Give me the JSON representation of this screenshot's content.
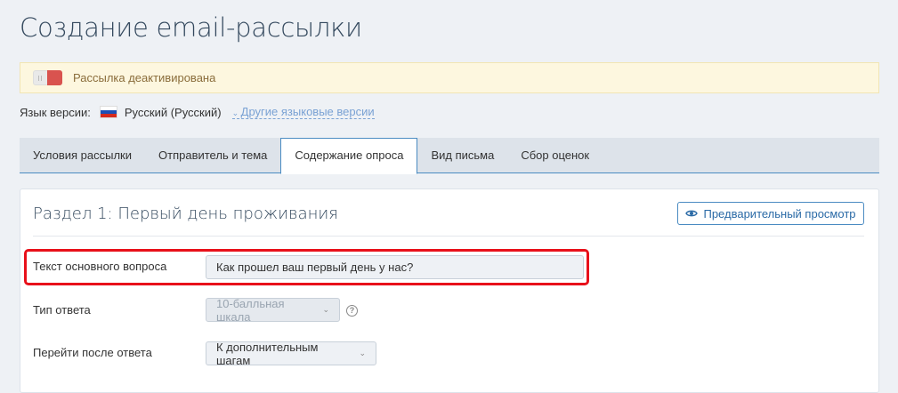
{
  "page_title": "Создание email-рассылки",
  "status_banner": {
    "text": "Рассылка деактивирована",
    "active": false
  },
  "language": {
    "label": "Язык версии:",
    "current": "Русский (Русский)",
    "other_link": "Другие языковые версии"
  },
  "tabs": [
    {
      "label": "Условия рассылки"
    },
    {
      "label": "Отправитель и тема"
    },
    {
      "label": "Содержание опроса",
      "active": true
    },
    {
      "label": "Вид письма"
    },
    {
      "label": "Сбор оценок"
    }
  ],
  "section": {
    "title": "Раздел 1: Первый день проживания",
    "preview_button": "Предварительный просмотр"
  },
  "fields": {
    "question_label": "Текст основного вопроса",
    "question_value": "Как прошел ваш первый день у нас?",
    "answer_type_label": "Тип ответа",
    "answer_type_value": "10-балльная шкала",
    "next_label": "Перейти после ответа",
    "next_value": "К дополнительным шагам"
  },
  "help_glyph": "?",
  "colors": {
    "accent": "#4a8bc2",
    "highlight": "#e8101a",
    "toggle_off": "#d9534f"
  }
}
